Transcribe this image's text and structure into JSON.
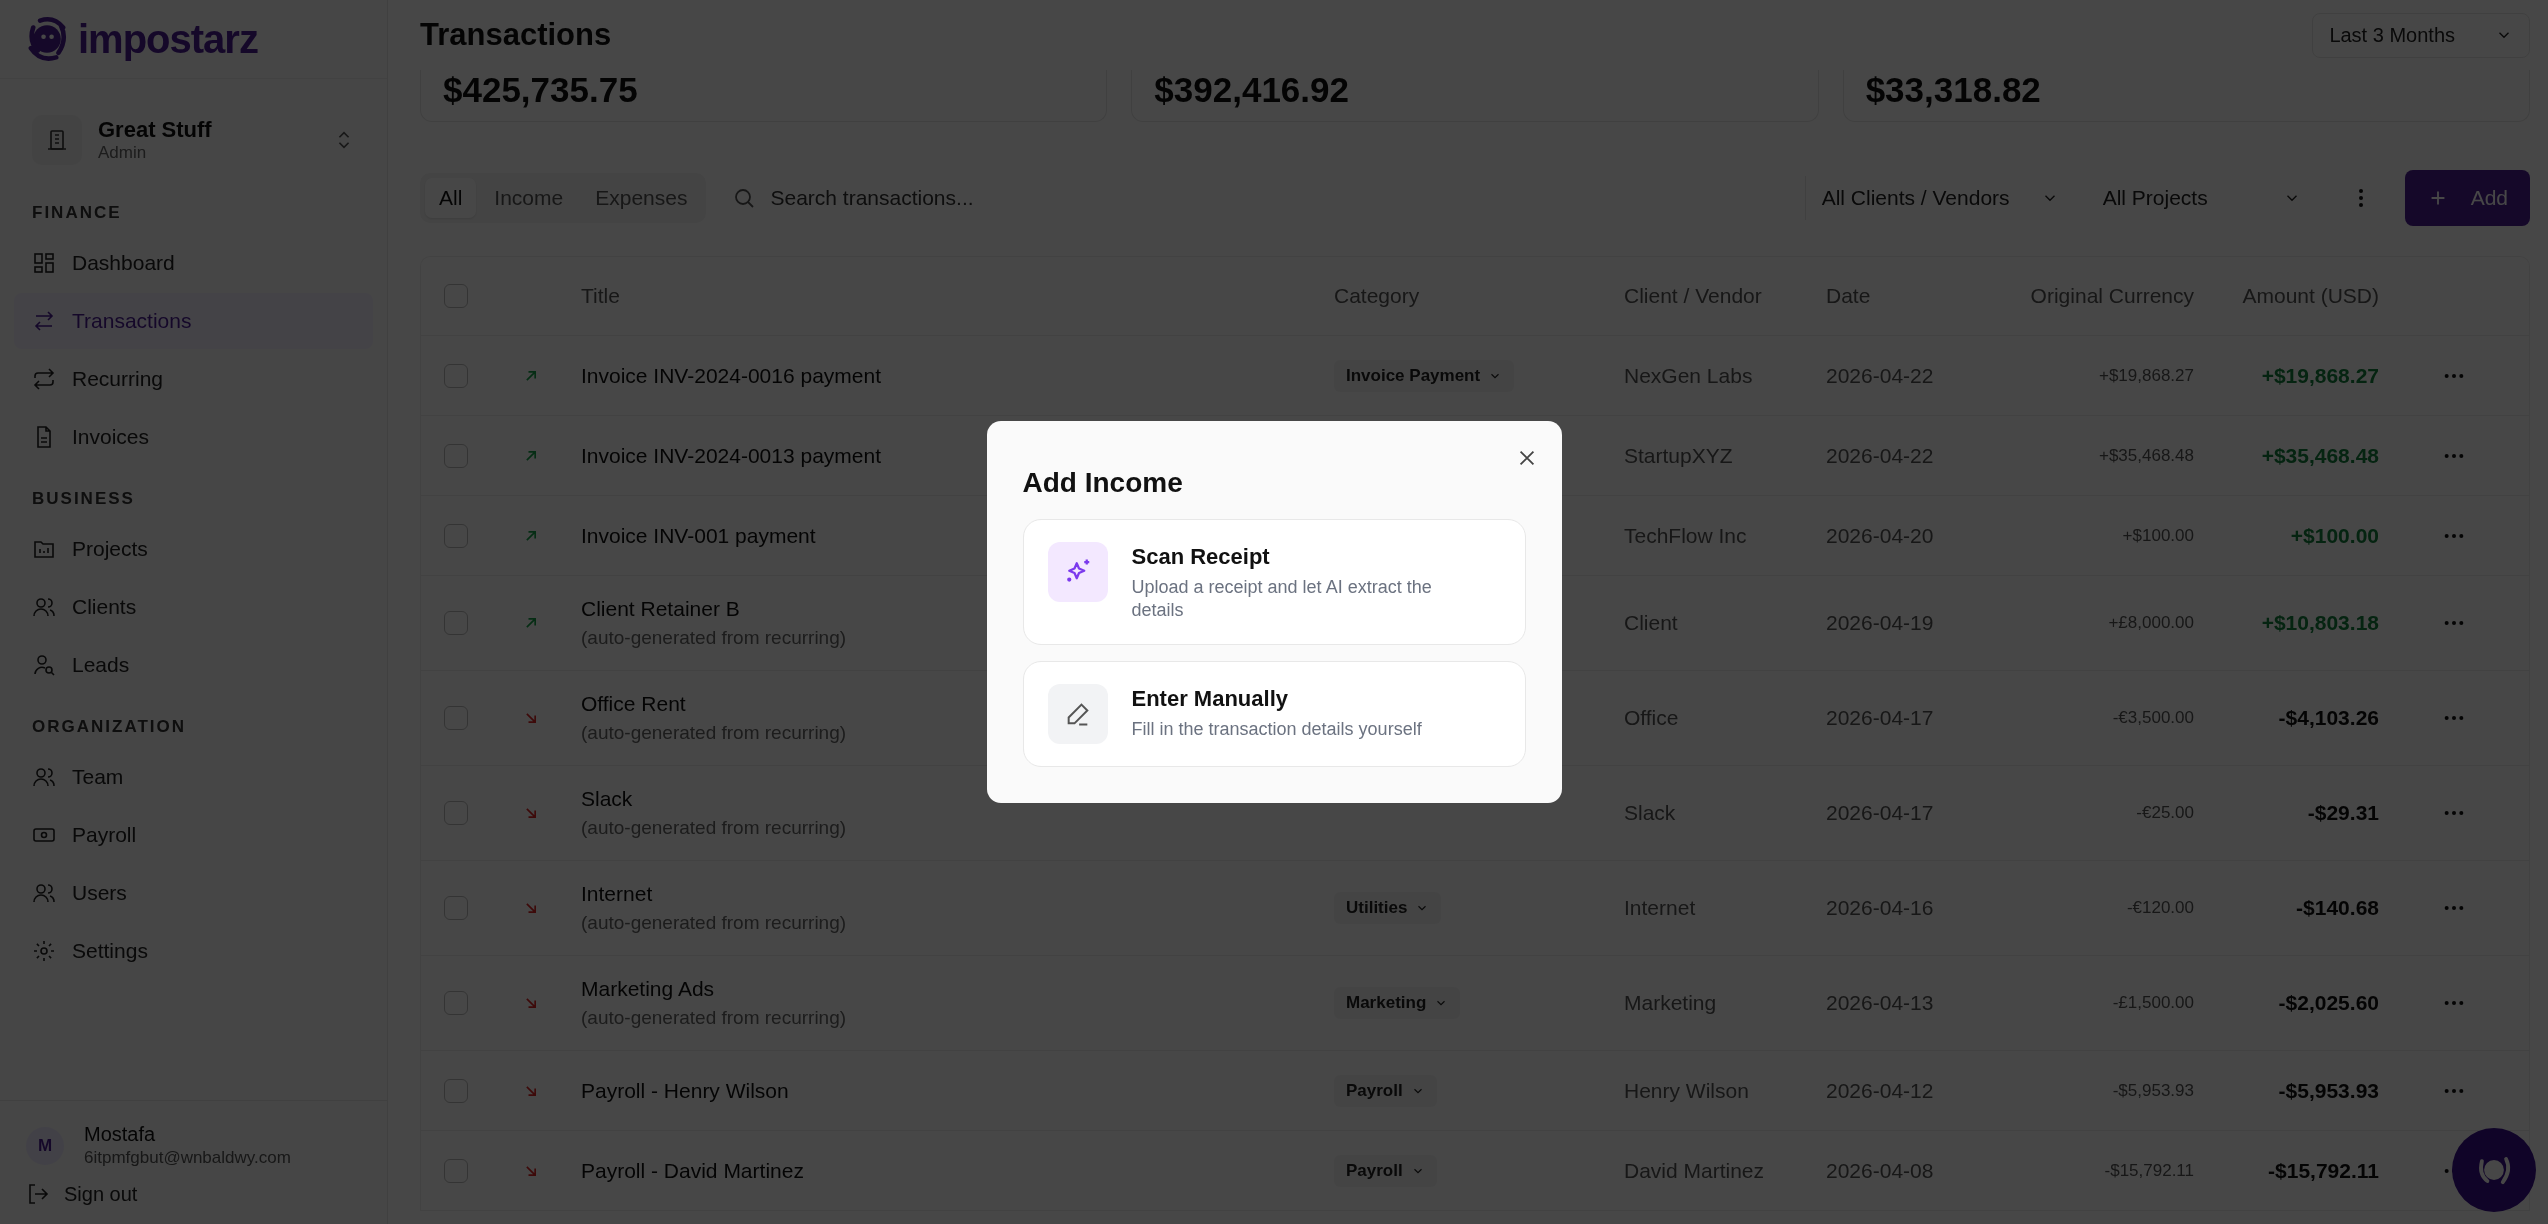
{
  "brand": {
    "name": "impostarz"
  },
  "workspace": {
    "name": "Great Stuff",
    "role": "Admin"
  },
  "nav": [
    {
      "heading": "FINANCE",
      "items": [
        {
          "label": "Dashboard",
          "selected": false
        },
        {
          "label": "Transactions",
          "selected": true
        },
        {
          "label": "Recurring",
          "selected": false
        },
        {
          "label": "Invoices",
          "selected": false
        }
      ]
    },
    {
      "heading": "BUSINESS",
      "items": [
        {
          "label": "Projects",
          "selected": false
        },
        {
          "label": "Clients",
          "selected": false
        },
        {
          "label": "Leads",
          "selected": false
        }
      ]
    },
    {
      "heading": "ORGANIZATION",
      "items": [
        {
          "label": "Team",
          "selected": false
        },
        {
          "label": "Payroll",
          "selected": false
        },
        {
          "label": "Users",
          "selected": false
        },
        {
          "label": "Settings",
          "selected": false
        }
      ]
    }
  ],
  "user": {
    "initial": "M",
    "name": "Mostafa",
    "email": "6itpmfgbut@wnbaldwy.com"
  },
  "sign_out": "Sign out",
  "page": {
    "title": "Transactions",
    "period": "Last 3 Months"
  },
  "stats": [
    "$425,735.75",
    "$392,416.92",
    "$33,318.82"
  ],
  "filters": {
    "tabs": [
      {
        "label": "All",
        "selected": true
      },
      {
        "label": "Income",
        "selected": false
      },
      {
        "label": "Expenses",
        "selected": false
      }
    ],
    "search_placeholder": "Search transactions...",
    "clients": "All Clients / Vendors",
    "projects": "All Projects",
    "add": "Add"
  },
  "table": {
    "select_all_checked": false,
    "columns": [
      "Title",
      "Category",
      "Client / Vendor",
      "Date",
      "Original Currency",
      "Amount (USD)"
    ],
    "rows": [
      {
        "kind": "income",
        "checked": false,
        "title": "Invoice INV-2024-0016 payment",
        "category": "Invoice Payment",
        "client": "NexGen Labs",
        "date": "2026-04-22",
        "original": "+$19,868.27",
        "amount": "+$19,868.27"
      },
      {
        "kind": "income",
        "checked": false,
        "title": "Invoice INV-2024-0013 payment",
        "client": "StartupXYZ",
        "date": "2026-04-22",
        "original": "+$35,468.48",
        "amount": "+$35,468.48"
      },
      {
        "kind": "income",
        "checked": false,
        "title": "Invoice INV-001 payment",
        "client": "TechFlow Inc",
        "date": "2026-04-20",
        "original": "+$100.00",
        "amount": "+$100.00"
      },
      {
        "kind": "income",
        "checked": false,
        "title": "Client Retainer B",
        "note": "(auto-generated from recurring)",
        "client": "Client",
        "date": "2026-04-19",
        "original": "+£8,000.00",
        "amount": "+$10,803.18"
      },
      {
        "kind": "expense",
        "checked": false,
        "title": "Office Rent",
        "note": "(auto-generated from recurring)",
        "client": "Office",
        "date": "2026-04-17",
        "original": "-€3,500.00",
        "amount": "-$4,103.26"
      },
      {
        "kind": "expense",
        "checked": false,
        "title": "Slack",
        "note": "(auto-generated from recurring)",
        "client": "Slack",
        "date": "2026-04-17",
        "original": "-€25.00",
        "amount": "-$29.31"
      },
      {
        "kind": "expense",
        "checked": false,
        "title": "Internet",
        "note": "(auto-generated from recurring)",
        "category": "Utilities",
        "client": "Internet",
        "date": "2026-04-16",
        "original": "-€120.00",
        "amount": "-$140.68"
      },
      {
        "kind": "expense",
        "checked": false,
        "title": "Marketing Ads",
        "note": "(auto-generated from recurring)",
        "category": "Marketing",
        "client": "Marketing",
        "date": "2026-04-13",
        "original": "-£1,500.00",
        "amount": "-$2,025.60"
      },
      {
        "kind": "expense",
        "checked": false,
        "title": "Payroll - Henry Wilson",
        "category": "Payroll",
        "client": "Henry Wilson",
        "date": "2026-04-12",
        "original": "-$5,953.93",
        "amount": "-$5,953.93"
      },
      {
        "kind": "expense",
        "checked": false,
        "title": "Payroll - David Martinez",
        "category": "Payroll",
        "client": "David Martinez",
        "date": "2026-04-08",
        "original": "-$15,792.11",
        "amount": "-$15,792.11"
      }
    ]
  },
  "dialog": {
    "title": "Add Income",
    "options": [
      {
        "kind": "scan",
        "title": "Scan Receipt",
        "description": "Upload a receipt and let AI extract the details"
      },
      {
        "kind": "manual",
        "title": "Enter Manually",
        "description": "Fill in the transaction details yourself"
      }
    ]
  }
}
